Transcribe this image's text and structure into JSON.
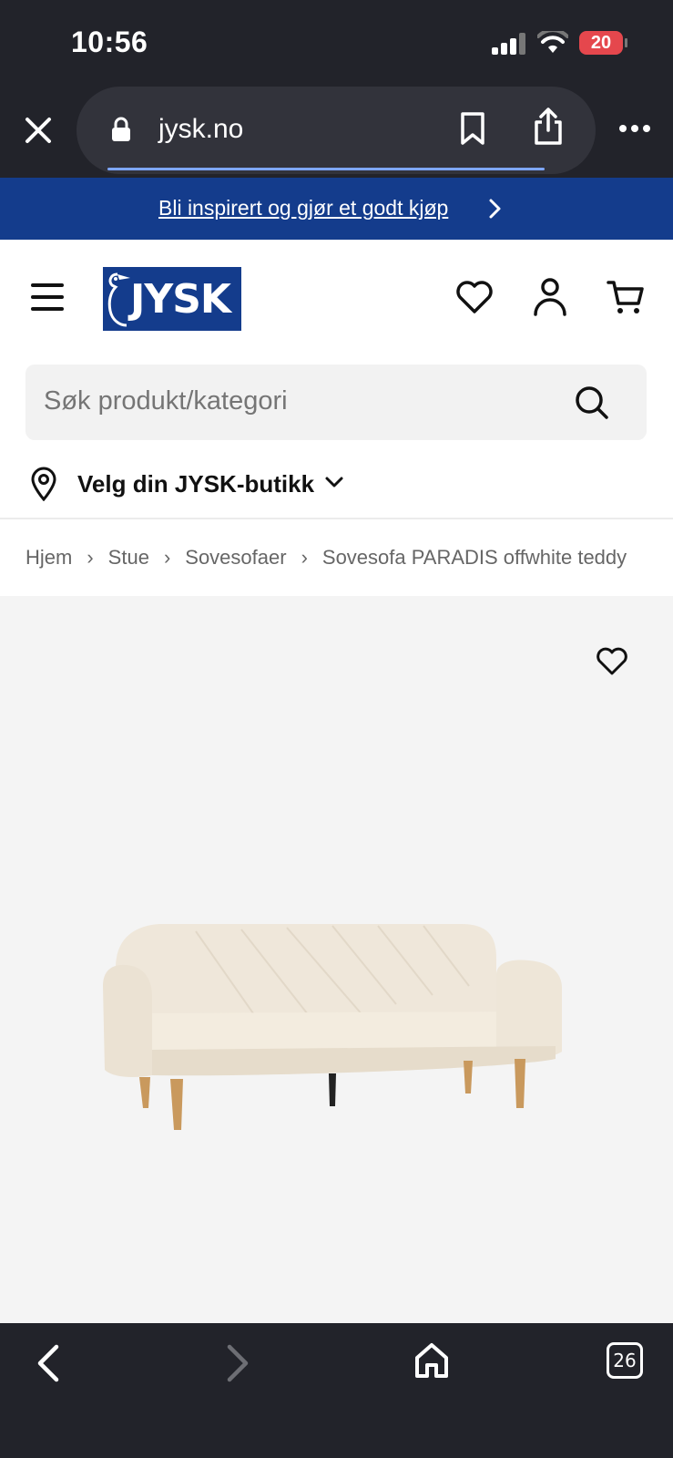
{
  "status_bar": {
    "time": "10:56",
    "battery": "20"
  },
  "browser": {
    "url": "jysk.no",
    "close_icon": "close-icon",
    "lock_icon": "lock-icon",
    "bookmark_icon": "bookmark-icon",
    "share_icon": "share-icon",
    "more_icon": "more-icon"
  },
  "promo": {
    "text": "Bli inspirert og gjør et godt kjøp",
    "color": "#143c8c"
  },
  "header": {
    "logo_text": "JYSK",
    "menu_icon": "hamburger-menu-icon",
    "favorites_icon": "heart-icon",
    "account_icon": "user-icon",
    "cart_icon": "cart-icon"
  },
  "search": {
    "placeholder": "Søk produkt/kategori",
    "icon": "search-icon"
  },
  "store": {
    "label": "Velg din JYSK-butikk"
  },
  "breadcrumb": {
    "items": [
      "Hjem",
      "Stue",
      "Sovesofaer",
      "Sovesofa PARADIS offwhite teddy"
    ]
  },
  "product": {
    "image_alt": "sofa-image",
    "favorite_icon": "heart-icon"
  },
  "toolbar": {
    "tab_count": "26",
    "back_icon": "back-icon",
    "forward_icon": "forward-icon",
    "home_icon": "home-icon"
  }
}
